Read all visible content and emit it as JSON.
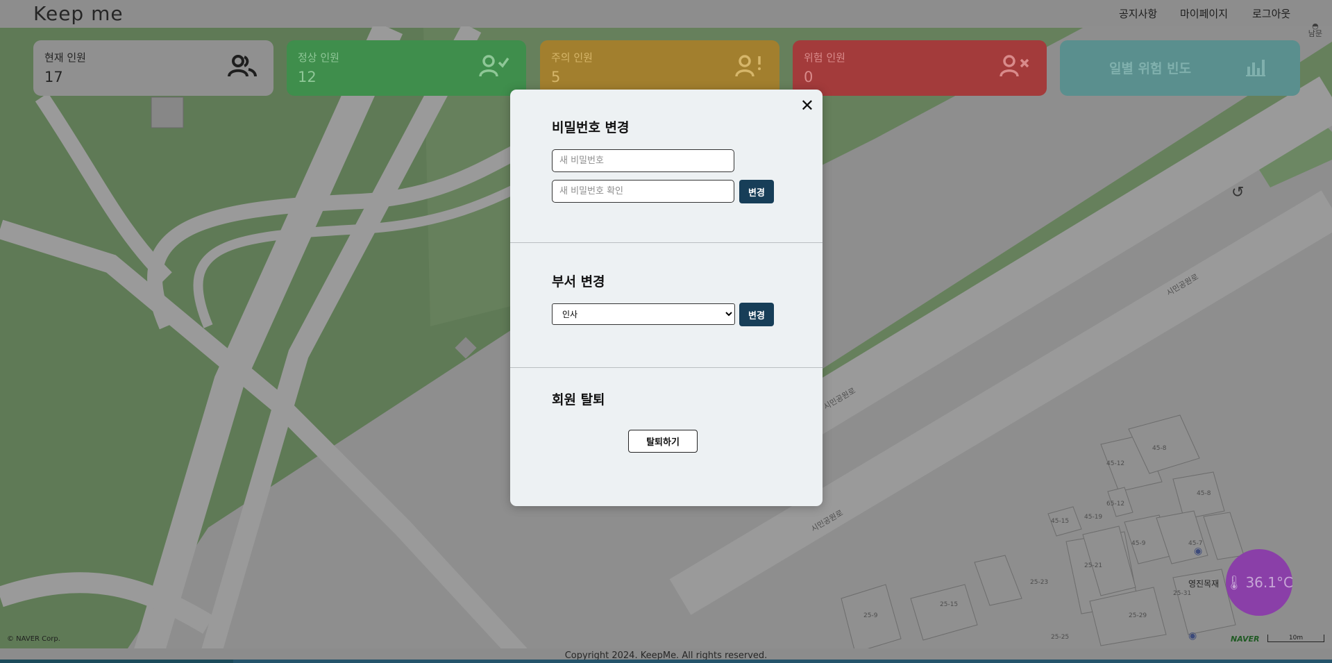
{
  "app": {
    "brand": "Keep me"
  },
  "nav": {
    "notice": "공지사항",
    "mypage": "마이페이지",
    "logout": "로그아웃"
  },
  "map": {
    "compass_label": "남문",
    "labels": [
      "시민공원로",
      "시민공원로",
      "시민공원로",
      "영진목재"
    ],
    "building_numbers": [
      "45-12",
      "45-8",
      "65-12",
      "45-19",
      "45-9",
      "45-7",
      "25-21",
      "25-23",
      "25-15",
      "25-9",
      "25-29",
      "25-25",
      "25-31",
      "45-8",
      "45-15"
    ],
    "attribution": "© NAVER Corp.",
    "naver_logo": "NAVER",
    "scale": "10m"
  },
  "stats": {
    "total": {
      "label": "현재 인원",
      "value": "17",
      "icon": "people-icon"
    },
    "normal": {
      "label": "정상 인원",
      "value": "12",
      "icon": "user-check-icon"
    },
    "warn": {
      "label": "주의 인원",
      "value": "5",
      "icon": "user-alert-icon"
    },
    "danger": {
      "label": "위험 인원",
      "value": "0",
      "icon": "user-x-icon"
    },
    "daily": {
      "label": "일별 위험 빈도",
      "icon": "bar-chart-icon"
    }
  },
  "temperature": {
    "value": "36.1°C",
    "icon": "thermometer-icon"
  },
  "modal": {
    "password": {
      "title": "비밀번호 변경",
      "new_placeholder": "새 비밀번호",
      "confirm_placeholder": "새 비밀번호 확인",
      "button": "변경"
    },
    "department": {
      "title": "부서 변경",
      "selected": "인사",
      "button": "변경"
    },
    "withdraw": {
      "title": "회원 탈퇴",
      "button": "탈퇴하기"
    }
  },
  "footer": {
    "copyright": "Copyright 2024. KeepMe. All rights reserved."
  },
  "colors": {
    "normal": "#3f8e4c",
    "warn": "#a27f2e",
    "danger": "#a33b3b",
    "daily": "#5a8f8e",
    "accent": "#173e58",
    "temperature": "#8a3fa8"
  }
}
